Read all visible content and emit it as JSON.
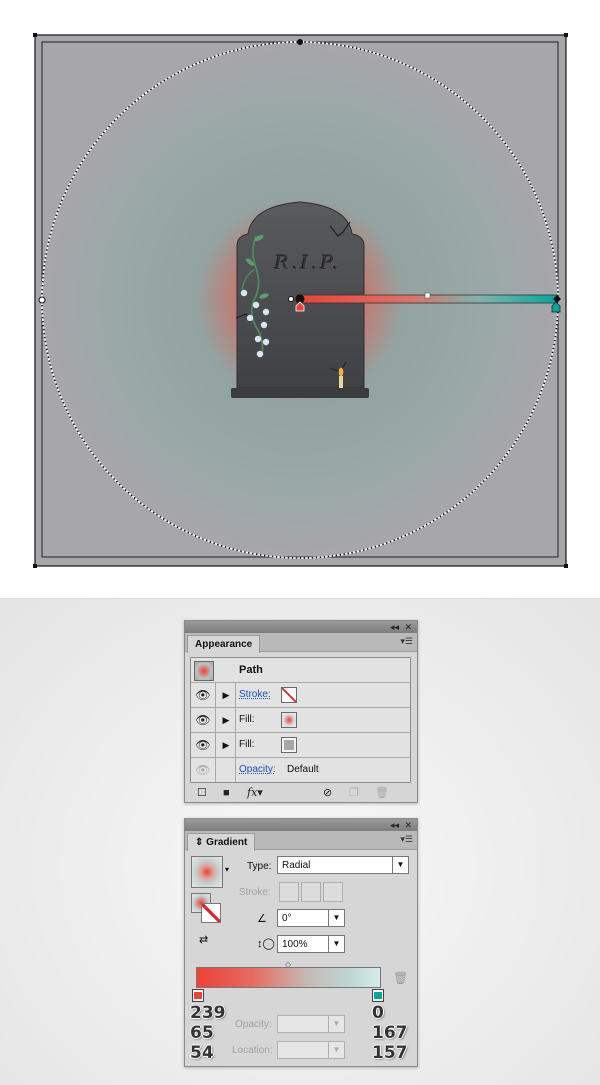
{
  "colors": {
    "stop_red": "#ef4136",
    "stop_teal": "#00a79d",
    "artboard_gray": "#a7a6ab",
    "glow_teal": "#8fa7a5"
  },
  "appearance_panel": {
    "tab": "Appearance",
    "header_label": "Path",
    "rows": [
      {
        "label": "Stroke:",
        "swatch": "none-swatch"
      },
      {
        "label": "Fill:",
        "swatch": "radial-gradient-swatch"
      },
      {
        "label": "Fill:",
        "swatch": "gray-swatch"
      }
    ],
    "opacity_label": "Opacity:",
    "opacity_value": "Default"
  },
  "gradient_panel": {
    "tab": "Gradient",
    "type_label": "Type:",
    "type_value": "Radial",
    "stroke_label": "Stroke:",
    "angle_value": "0°",
    "aspect_value": "100%",
    "opacity_label": "Opacity:",
    "location_label": "Location:",
    "left_stop_rgb": [
      "239",
      "65",
      "54"
    ],
    "right_stop_rgb": [
      "0",
      "167",
      "157"
    ]
  },
  "artwork": {
    "epitaph": "R.I.P."
  }
}
